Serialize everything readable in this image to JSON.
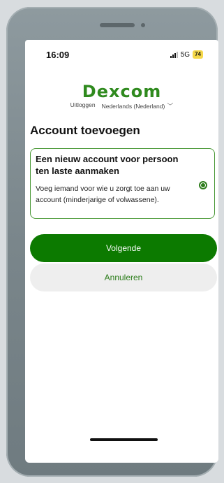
{
  "status_bar": {
    "time": "16:09",
    "network": "5G",
    "battery": "74"
  },
  "header": {
    "logo": "Dexcom",
    "logout_label": "Uitloggen",
    "language": "Nederlands (Nederland)"
  },
  "main": {
    "title": "Account toevoegen",
    "option": {
      "title": "Een nieuw account voor persoon ten laste aanmaken",
      "description": "Voeg iemand voor wie u zorgt toe aan uw account (minderjarige of volwassene).",
      "selected": true
    },
    "next_label": "Volgende",
    "cancel_label": "Annuleren"
  },
  "colors": {
    "brand_green": "#2f8a1e",
    "primary_button": "#0c7a00",
    "secondary_button": "#eeeeee",
    "card_border": "#4c9a39"
  },
  "icons": [
    "signal-icon",
    "battery-icon",
    "chevron-down-icon",
    "radio-selected-icon"
  ]
}
